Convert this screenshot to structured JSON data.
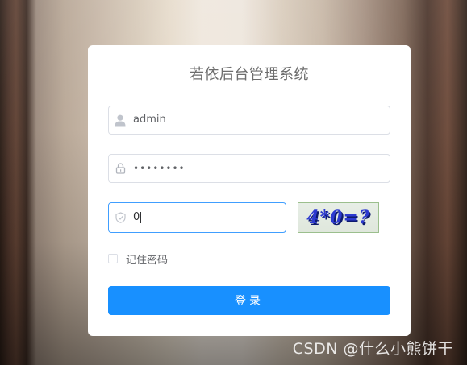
{
  "login": {
    "title": "若依后台管理系统",
    "username": {
      "value": "admin",
      "icon": "user-icon"
    },
    "password": {
      "value": "••••••••",
      "icon": "lock-icon"
    },
    "code": {
      "value": "0",
      "icon": "shield-icon"
    },
    "captcha_text": "4*0=?",
    "remember_label": "记住密码",
    "remember_checked": false,
    "submit_label": "登录"
  },
  "watermark": "CSDN @什么小熊饼干",
  "colors": {
    "primary": "#1890ff",
    "focus_border": "#409eff",
    "input_border": "#dcdfe6",
    "captcha_text": "#2d3ad0"
  }
}
